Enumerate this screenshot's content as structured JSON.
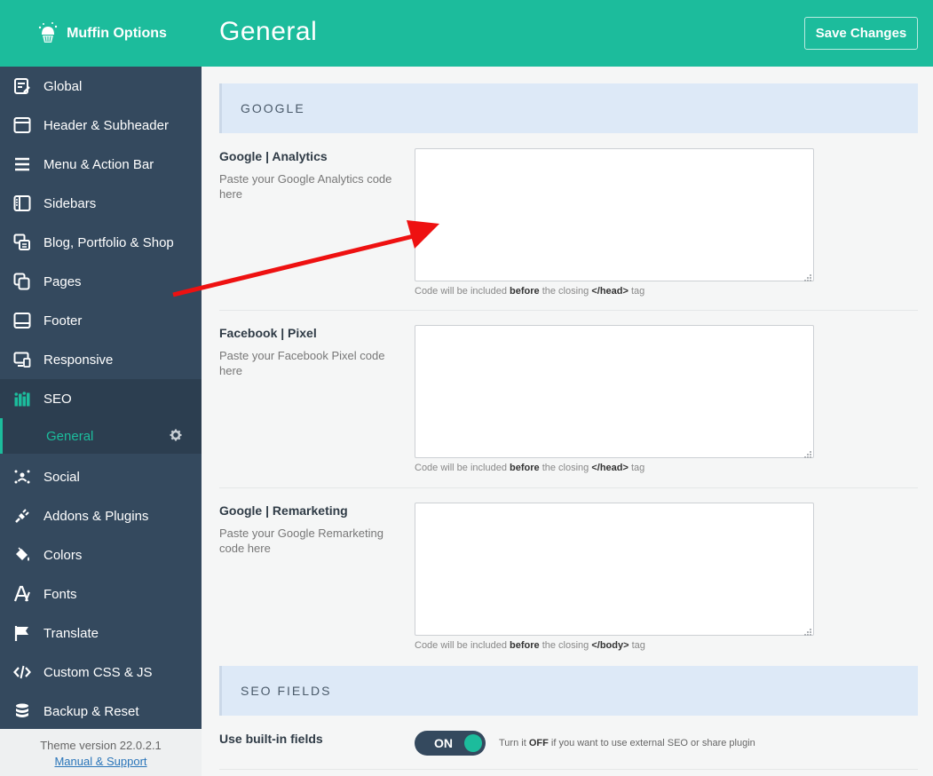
{
  "brand": {
    "title": "Muffin Options"
  },
  "header": {
    "title": "General",
    "save_label": "Save Changes"
  },
  "sidebar": {
    "items": [
      {
        "label": "Global",
        "icon": "document-edit-icon"
      },
      {
        "label": "Header & Subheader",
        "icon": "window-icon"
      },
      {
        "label": "Menu & Action Bar",
        "icon": "menu-icon"
      },
      {
        "label": "Sidebars",
        "icon": "sidebar-icon"
      },
      {
        "label": "Blog, Portfolio & Shop",
        "icon": "blog-icon"
      },
      {
        "label": "Pages",
        "icon": "pages-icon"
      },
      {
        "label": "Footer",
        "icon": "footer-icon"
      },
      {
        "label": "Responsive",
        "icon": "responsive-icon"
      },
      {
        "label": "SEO",
        "icon": "chart-bars-icon"
      },
      {
        "label": "Social",
        "icon": "social-icon"
      },
      {
        "label": "Addons & Plugins",
        "icon": "plug-icon"
      },
      {
        "label": "Colors",
        "icon": "paint-bucket-icon"
      },
      {
        "label": "Fonts",
        "icon": "font-icon"
      },
      {
        "label": "Translate",
        "icon": "flag-icon"
      },
      {
        "label": "Custom CSS & JS",
        "icon": "code-icon"
      },
      {
        "label": "Backup & Reset",
        "icon": "database-icon"
      }
    ],
    "sub_item": {
      "label": "General",
      "icon": "gear-icon"
    },
    "footer": {
      "version": "Theme version 22.0.2.1",
      "support_link": "Manual & Support"
    }
  },
  "sections": [
    {
      "title": "GOOGLE"
    },
    {
      "title": "SEO FIELDS"
    }
  ],
  "fields": [
    {
      "title": "Google | Analytics",
      "desc": "Paste your Google Analytics code here",
      "value": "",
      "note_prefix": "Code will be included",
      "note_bold1": "before",
      "note_mid": "the closing",
      "note_bold2": "</head>",
      "note_suffix": "tag"
    },
    {
      "title": "Facebook | Pixel",
      "desc": "Paste your Facebook Pixel code here",
      "value": "",
      "note_prefix": "Code will be included",
      "note_bold1": "before",
      "note_mid": "the closing",
      "note_bold2": "</head>",
      "note_suffix": "tag"
    },
    {
      "title": "Google | Remarketing",
      "desc": "Paste your Google Remarketing code here",
      "value": "",
      "note_prefix": "Code will be included",
      "note_bold1": "before",
      "note_mid": "the closing",
      "note_bold2": "</body>",
      "note_suffix": "tag"
    }
  ],
  "builtin": {
    "title": "Use built-in fields",
    "toggle_label": "ON",
    "note_prefix": "Turn it",
    "note_bold": "OFF",
    "note_suffix": "if you want to use external SEO or share plugin"
  },
  "colors": {
    "accent": "#1cbc9c",
    "sidebar": "#34495e",
    "section": "#dde9f7",
    "annotation_arrow": "#ee1111"
  }
}
